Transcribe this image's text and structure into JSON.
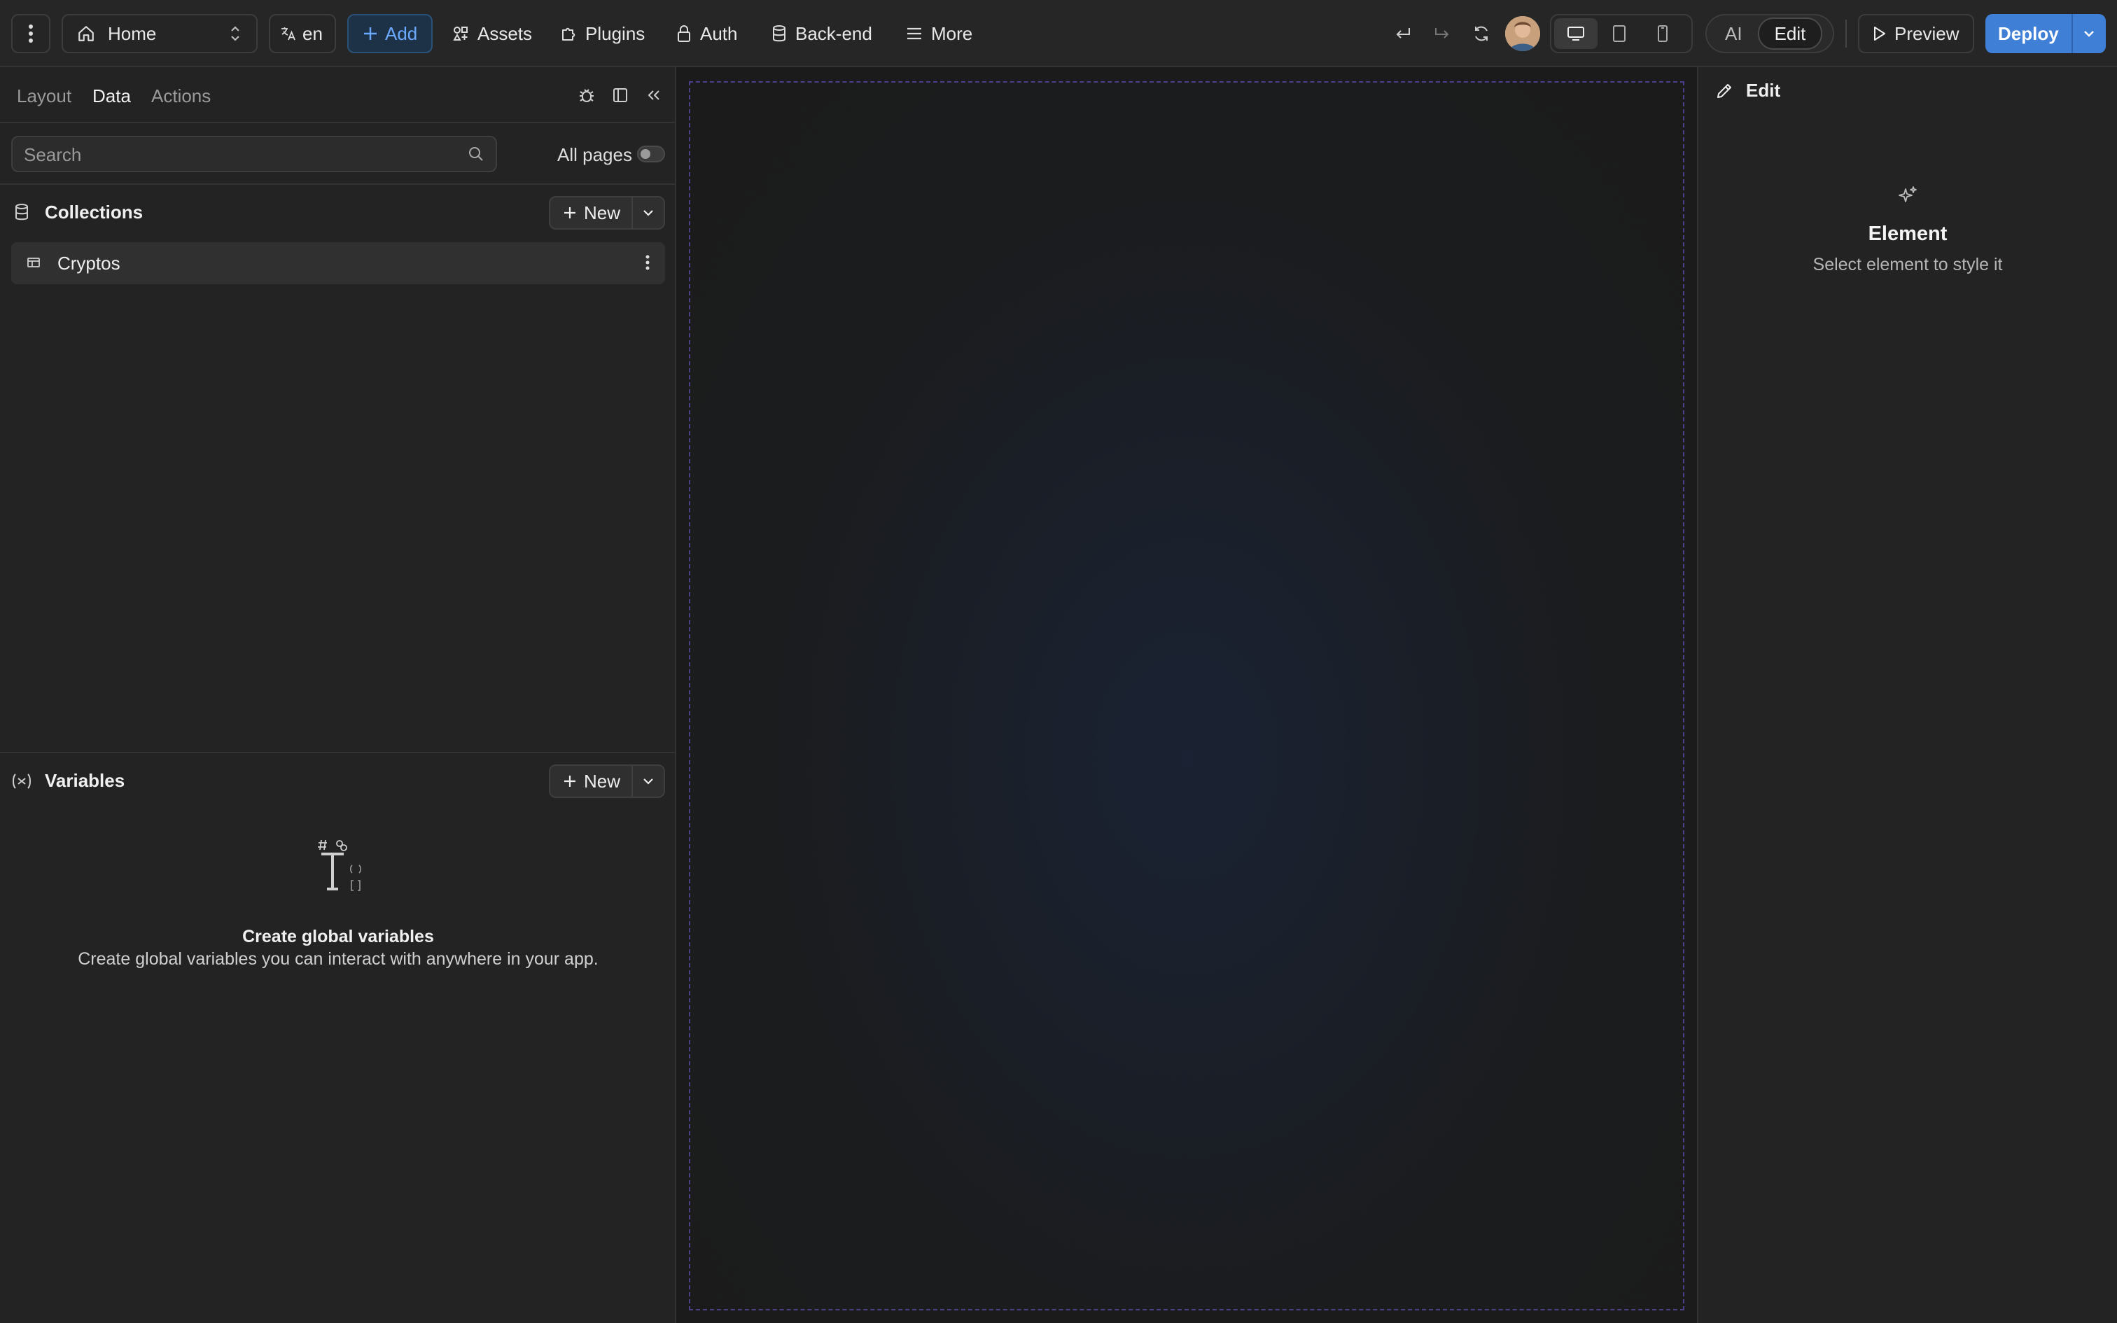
{
  "topbar": {
    "page_selector": "Home",
    "language": "en",
    "add_label": "Add",
    "nav": [
      "Assets",
      "Plugins",
      "Auth",
      "Back-end",
      "More"
    ],
    "mode_ai": "AI",
    "mode_edit": "Edit",
    "preview_label": "Preview",
    "deploy_label": "Deploy"
  },
  "left_panel": {
    "tabs": [
      "Layout",
      "Data",
      "Actions"
    ],
    "active_tab": "Data",
    "search_placeholder": "Search",
    "all_pages_label": "All pages",
    "collections_title": "Collections",
    "collections_new": "New",
    "collections": [
      "Cryptos"
    ],
    "variables_title": "Variables",
    "variables_new": "New",
    "variables_empty_title": "Create global variables",
    "variables_empty_desc": "Create global variables you can interact with anywhere in your app."
  },
  "right_panel": {
    "header": "Edit",
    "title": "Element",
    "subtitle": "Select element to style it"
  },
  "colors": {
    "accent": "#3f7fd6",
    "add_text": "#6aa9ff",
    "canvas_border": "#4e3f8a"
  }
}
